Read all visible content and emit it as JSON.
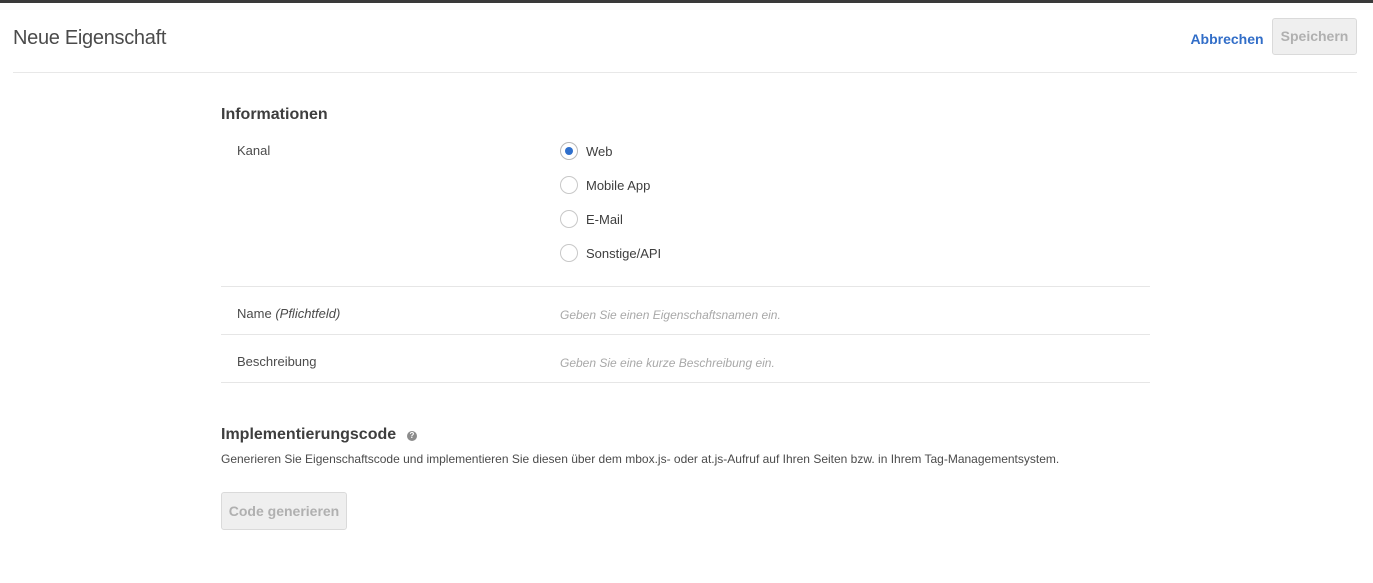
{
  "header": {
    "title": "Neue Eigenschaft",
    "cancel_label": "Abbrechen",
    "save_label": "Speichern"
  },
  "informationen": {
    "title": "Informationen",
    "kanal_label": "Kanal",
    "kanal_options": [
      {
        "label": "Web",
        "selected": true
      },
      {
        "label": "Mobile App",
        "selected": false
      },
      {
        "label": "E-Mail",
        "selected": false
      },
      {
        "label": "Sonstige/API",
        "selected": false
      }
    ],
    "name_label": "Name",
    "name_required": "(Pflichtfeld)",
    "name_placeholder": "Geben Sie einen Eigenschaftsnamen ein.",
    "name_value": "",
    "description_label": "Beschreibung",
    "description_placeholder": "Geben Sie eine kurze Beschreibung ein.",
    "description_value": ""
  },
  "implementation": {
    "title": "Implementierungscode",
    "help_icon": "question-circle-icon",
    "description": "Generieren Sie Eigenschaftscode und implementieren Sie diesen über dem mbox.js- oder at.js-Aufruf auf Ihren Seiten bzw. in Ihrem Tag-Managementsystem.",
    "generate_label": "Code generieren"
  },
  "colors": {
    "accent": "#326ec8",
    "radio_selected": "#2f6fcc",
    "disabled_button_bg": "#efefef",
    "disabled_button_text": "#b0b0b0"
  }
}
